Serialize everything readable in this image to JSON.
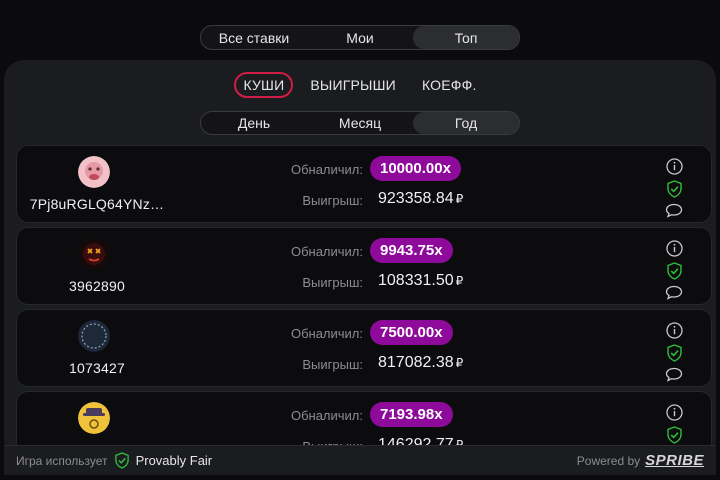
{
  "tabs_main": {
    "items": [
      "Все ставки",
      "Мои",
      "Топ"
    ],
    "active": "Топ"
  },
  "category_tabs": {
    "items": [
      "КУШИ",
      "ВЫИГРЫШИ",
      "КОЕФФ."
    ],
    "active": "КУШИ"
  },
  "period_tabs": {
    "items": [
      "День",
      "Месяц",
      "Год"
    ],
    "active": "Год"
  },
  "labels": {
    "cashed": "Обналичил:",
    "win": "Выигрыш:"
  },
  "entries": [
    {
      "username": "7Pj8uRGLQ64YNz…",
      "multiplier": "10000.00x",
      "amount": "923358.84",
      "currency": "₽"
    },
    {
      "username": "3962890",
      "multiplier": "9943.75x",
      "amount": "108331.50",
      "currency": "₽"
    },
    {
      "username": "1073427",
      "multiplier": "7500.00x",
      "amount": "817082.38",
      "currency": "₽"
    },
    {
      "username": "",
      "multiplier": "7193.98x",
      "amount": "146292.77",
      "currency": "₽"
    }
  ],
  "footer": {
    "uses": "Игра использует",
    "provably": "Provably Fair",
    "powered": "Powered by",
    "brand": "SPRIBE"
  },
  "colors": {
    "accent_multiplier": "#8d0a9b",
    "active_tab_border": "#d11c45",
    "shield_green": "#2fbf3a"
  },
  "icons": [
    "info-icon",
    "shield-check-icon",
    "chat-bubble-icon"
  ]
}
